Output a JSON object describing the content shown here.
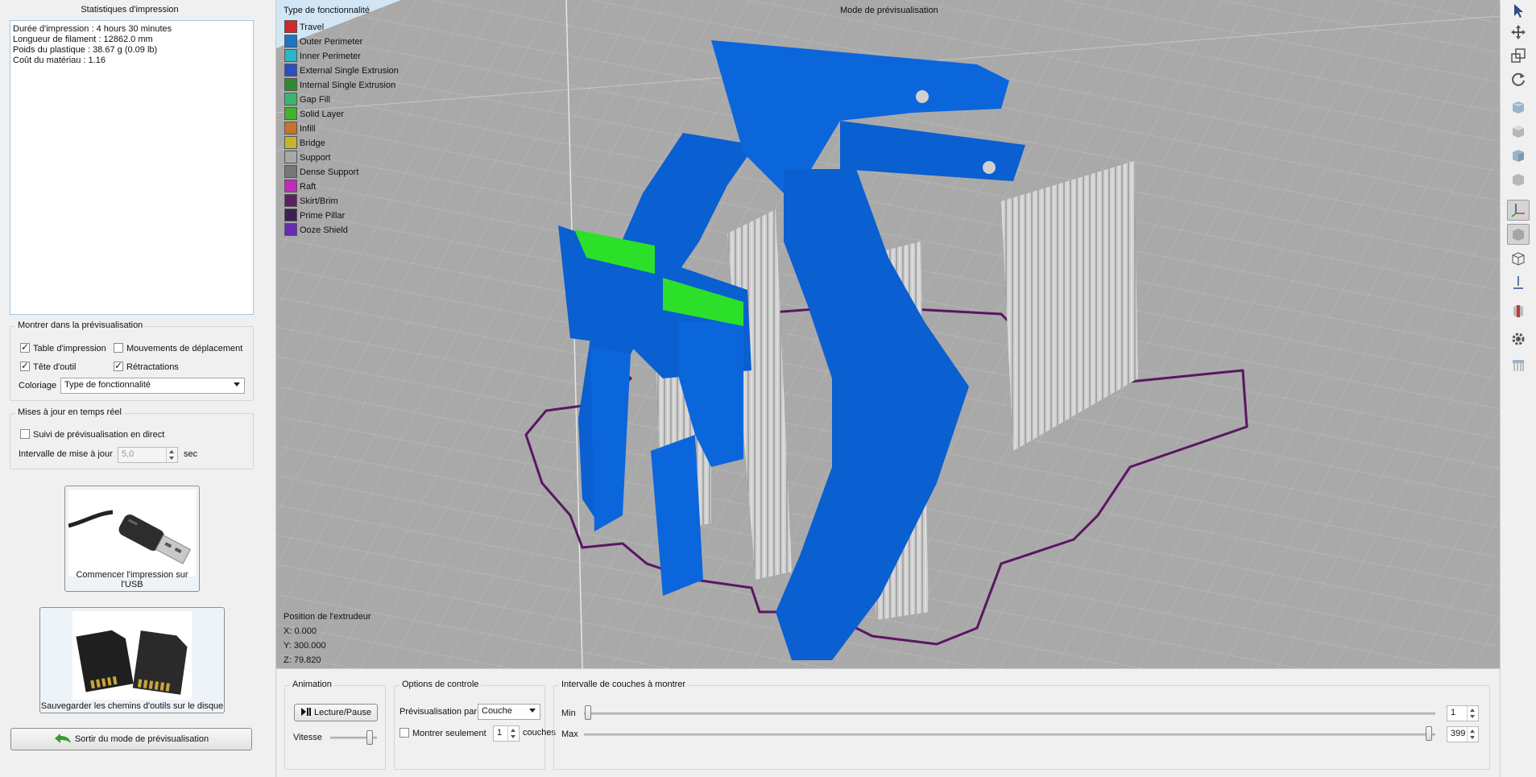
{
  "stats": {
    "title": "Statistiques d'impression",
    "lines": [
      "Durée d'impression : 4 hours 30 minutes",
      "Longueur de filament : 12862.0 mm",
      "Poids du plastique : 38.67 g (0.09 lb)",
      "Coût du matériau : 1.16"
    ]
  },
  "show": {
    "title": "Montrer dans la prévisualisation",
    "bed_label": "Table d'impression",
    "bed_checked": true,
    "travel_label": "Mouvements de déplacement",
    "travel_checked": false,
    "head_label": "Tête d'outil",
    "head_checked": true,
    "retract_label": "Rétractations",
    "retract_checked": true,
    "coloring_label": "Coloriage",
    "coloring_value": "Type de fonctionnalité"
  },
  "realtime": {
    "title": "Mises à jour en temps réel",
    "live_label": "Suivi de prévisualisation en direct",
    "live_checked": false,
    "interval_label": "Intervalle de mise à jour",
    "interval_value": "5,0",
    "interval_unit": "sec"
  },
  "actions": {
    "usb_label": "Commencer l'impression sur l'USB",
    "save_label": "Sauvegarder les chemins d'outils sur le disque",
    "exit_label": "Sortir du mode de prévisualisation"
  },
  "viewport": {
    "legend_title": "Type de fonctionnalité",
    "mode_label": "Mode de prévisualisation",
    "legend": [
      {
        "label": "Travel",
        "color": "#d1262b"
      },
      {
        "label": "Outer Perimeter",
        "color": "#1c74c4"
      },
      {
        "label": "Inner Perimeter",
        "color": "#2ab6c6"
      },
      {
        "label": "External Single Extrusion",
        "color": "#2b4ec0"
      },
      {
        "label": "Internal Single Extrusion",
        "color": "#2f8a2f"
      },
      {
        "label": "Gap Fill",
        "color": "#3ab56e"
      },
      {
        "label": "Solid Layer",
        "color": "#3fb42a"
      },
      {
        "label": "Infill",
        "color": "#c8722a"
      },
      {
        "label": "Bridge",
        "color": "#c3b52b"
      },
      {
        "label": "Support",
        "color": "#a8a8a8"
      },
      {
        "label": "Dense Support",
        "color": "#777777"
      },
      {
        "label": "Raft",
        "color": "#c12bb8"
      },
      {
        "label": "Skirt/Brim",
        "color": "#5e1f62"
      },
      {
        "label": "Prime Pillar",
        "color": "#3b1f56"
      },
      {
        "label": "Ooze Shield",
        "color": "#6a2bb0"
      }
    ],
    "extruder_title": "Position de l'extrudeur",
    "x": "X: 0.000",
    "y": "Y: 300.000",
    "z": "Z: 79.820"
  },
  "bottom": {
    "animation_title": "Animation",
    "play_label": "Lecture/Pause",
    "speed_label": "Vitesse",
    "control_title": "Options de controle",
    "preview_by_label": "Prévisualisation par",
    "preview_by_value": "Couche",
    "show_only_label": "Montrer seulement",
    "show_only_checked": false,
    "show_only_value": "1",
    "layers_unit": "couches",
    "range_title": "Intervalle de couches à montrer",
    "min_label": "Min",
    "min_value": "1",
    "max_label": "Max",
    "max_value": "399"
  },
  "toolbar": {
    "icons": [
      "pointer-icon",
      "move-icon",
      "scale-icon",
      "rotate-icon",
      "view-front-icon",
      "view-top-icon",
      "view-side-icon",
      "view-iso-icon",
      "axes-icon",
      "solid-view-icon",
      "wireframe-icon",
      "layer-pin-icon",
      "cut-icon",
      "settings-icon",
      "supports-icon"
    ]
  }
}
